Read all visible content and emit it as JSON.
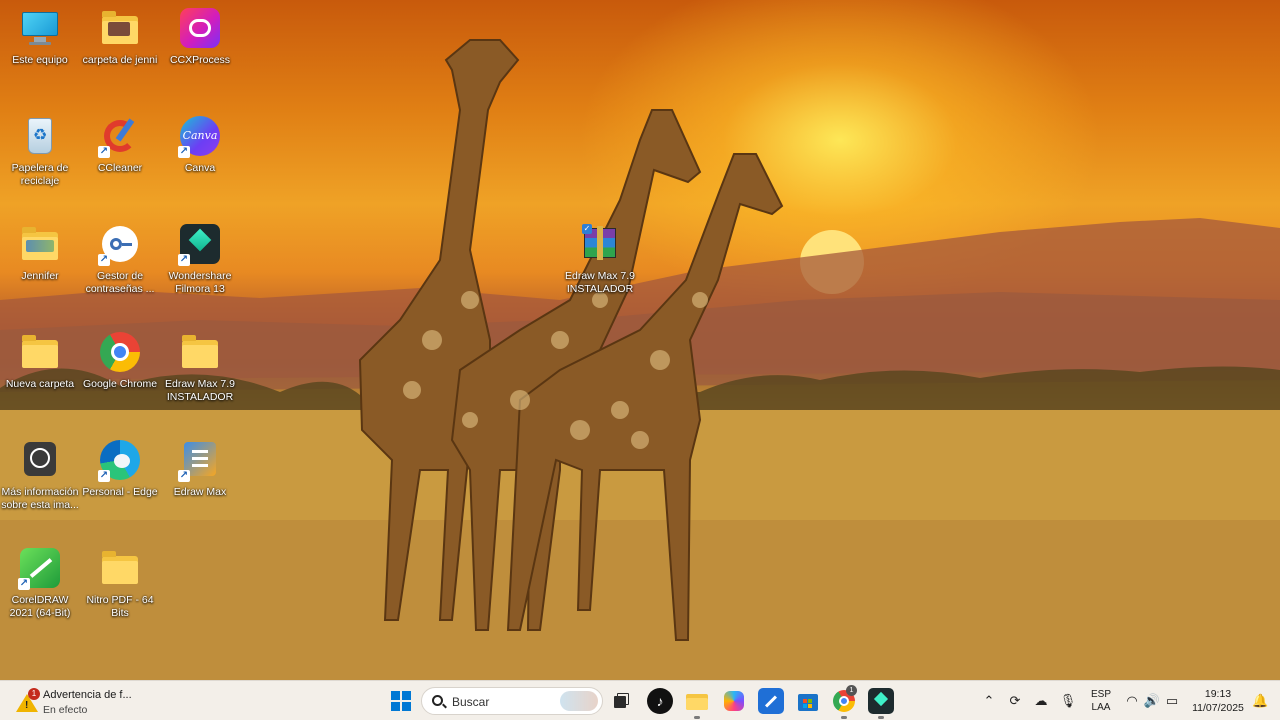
{
  "desktop": {
    "icons": [
      {
        "label": "Este equipo",
        "icon": "monitor-icon"
      },
      {
        "label": "carpeta de jenni",
        "icon": "folder-icon"
      },
      {
        "label": "CCXProcess",
        "icon": "adobe-cc-icon"
      },
      {
        "label": "Papelera de reciclaje",
        "icon": "recycle-bin-icon"
      },
      {
        "label": "CCleaner",
        "icon": "ccleaner-icon"
      },
      {
        "label": "Canva",
        "icon": "canva-icon",
        "glyph_text": "Canva"
      },
      {
        "label": "Jennifer",
        "icon": "folder-icon"
      },
      {
        "label": "Gestor de contraseñas ...",
        "icon": "key-icon"
      },
      {
        "label": "Wondershare Filmora 13",
        "icon": "filmora-icon"
      },
      {
        "label": "Edraw Max 7.9 INSTALADOR",
        "icon": "winrar-archive-icon"
      },
      {
        "label": "Nueva carpeta",
        "icon": "folder-icon"
      },
      {
        "label": "Google Chrome",
        "icon": "chrome-icon"
      },
      {
        "label": "Edraw Max 7.9 INSTALADOR",
        "icon": "folder-icon"
      },
      {
        "label": "Más información sobre esta ima...",
        "icon": "camera-info-icon"
      },
      {
        "label": "Personal - Edge",
        "icon": "edge-icon"
      },
      {
        "label": "Edraw Max",
        "icon": "edraw-icon"
      },
      {
        "label": "CorelDRAW 2021 (64-Bit)",
        "icon": "coreldraw-icon"
      },
      {
        "label": "Nitro PDF - 64 Bits",
        "icon": "folder-icon"
      }
    ]
  },
  "taskbar": {
    "notification": {
      "badge": "1",
      "title": "Advertencia de f...",
      "subtitle": "En efecto"
    },
    "search": {
      "placeholder": "Buscar"
    },
    "pinned": [
      "windows-start-icon",
      "task-view-icon",
      "tiktok-icon",
      "file-explorer-icon",
      "copilot-icon",
      "edraw-taskbar-icon",
      "microsoft-store-icon",
      "chrome-taskbar-icon",
      "filmora-taskbar-icon"
    ],
    "chrome_badge": "1",
    "language": {
      "line1": "ESP",
      "line2": "LAA"
    },
    "clock": {
      "time": "19:13",
      "date": "11/07/2025"
    }
  },
  "colors": {
    "accent": "#0078d4",
    "taskbar_bg": "#f3efe9"
  }
}
